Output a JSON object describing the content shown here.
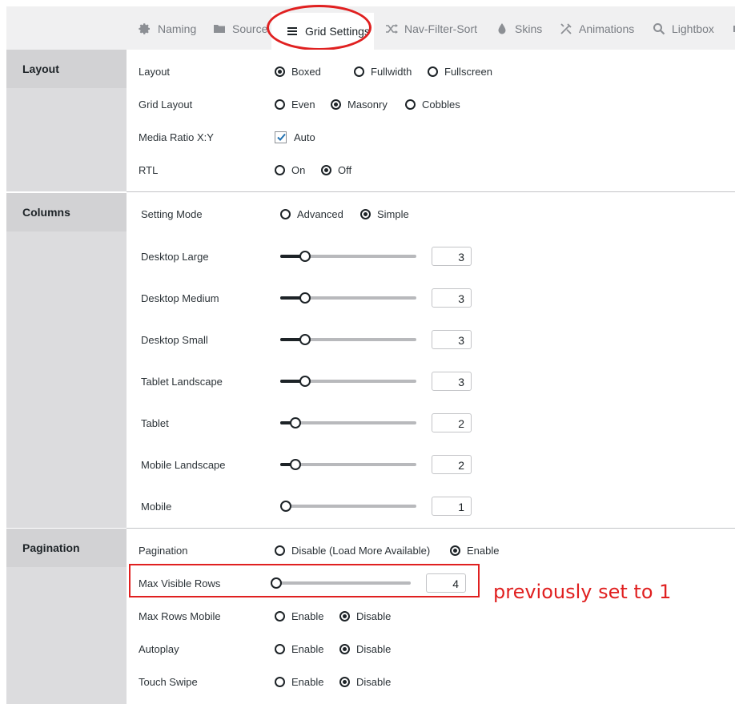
{
  "tabs": [
    {
      "label": "Naming",
      "icon": "gear-icon"
    },
    {
      "label": "Source",
      "icon": "folder-icon"
    },
    {
      "label": "Grid Settings",
      "icon": "menu-lines-icon",
      "active": true
    },
    {
      "label": "Nav-Filter-Sort",
      "icon": "shuffle-icon"
    },
    {
      "label": "Skins",
      "icon": "drop-icon"
    },
    {
      "label": "Animations",
      "icon": "tools-icon"
    },
    {
      "label": "Lightbox",
      "icon": "search-icon"
    }
  ],
  "layout": {
    "title": "Layout",
    "layout": {
      "label": "Layout",
      "options": [
        "Boxed",
        "Fullwidth",
        "Fullscreen"
      ],
      "selected": "Boxed"
    },
    "grid_layout": {
      "label": "Grid Layout",
      "options": [
        "Even",
        "Masonry",
        "Cobbles"
      ],
      "selected": "Masonry"
    },
    "media_ratio": {
      "label": "Media Ratio X:Y",
      "checkbox_label": "Auto",
      "checked": true
    },
    "rtl": {
      "label": "RTL",
      "options": [
        "On",
        "Off"
      ],
      "selected": "Off"
    }
  },
  "columns": {
    "title": "Columns",
    "setting_mode": {
      "label": "Setting Mode",
      "options": [
        "Advanced",
        "Simple"
      ],
      "selected": "Simple"
    },
    "sliders": [
      {
        "label": "Desktop Large",
        "value": "3"
      },
      {
        "label": "Desktop Medium",
        "value": "3"
      },
      {
        "label": "Desktop Small",
        "value": "3"
      },
      {
        "label": "Tablet Landscape",
        "value": "3"
      },
      {
        "label": "Tablet",
        "value": "2"
      },
      {
        "label": "Mobile Landscape",
        "value": "2"
      },
      {
        "label": "Mobile",
        "value": "1"
      }
    ]
  },
  "pagination": {
    "title": "Pagination",
    "pagination": {
      "label": "Pagination",
      "options": [
        "Disable (Load More Available)",
        "Enable"
      ],
      "selected": "Enable"
    },
    "max_visible_rows": {
      "label": "Max Visible Rows",
      "value": "4"
    },
    "max_rows_mobile": {
      "label": "Max Rows Mobile",
      "options": [
        "Enable",
        "Disable"
      ],
      "selected": "Disable"
    },
    "autoplay": {
      "label": "Autoplay",
      "options": [
        "Enable",
        "Disable"
      ],
      "selected": "Disable"
    },
    "touch_swipe": {
      "label": "Touch Swipe",
      "options": [
        "Enable",
        "Disable"
      ],
      "selected": "Disable"
    }
  },
  "annotation": {
    "note": "previously set to 1",
    "color": "#e02020"
  }
}
